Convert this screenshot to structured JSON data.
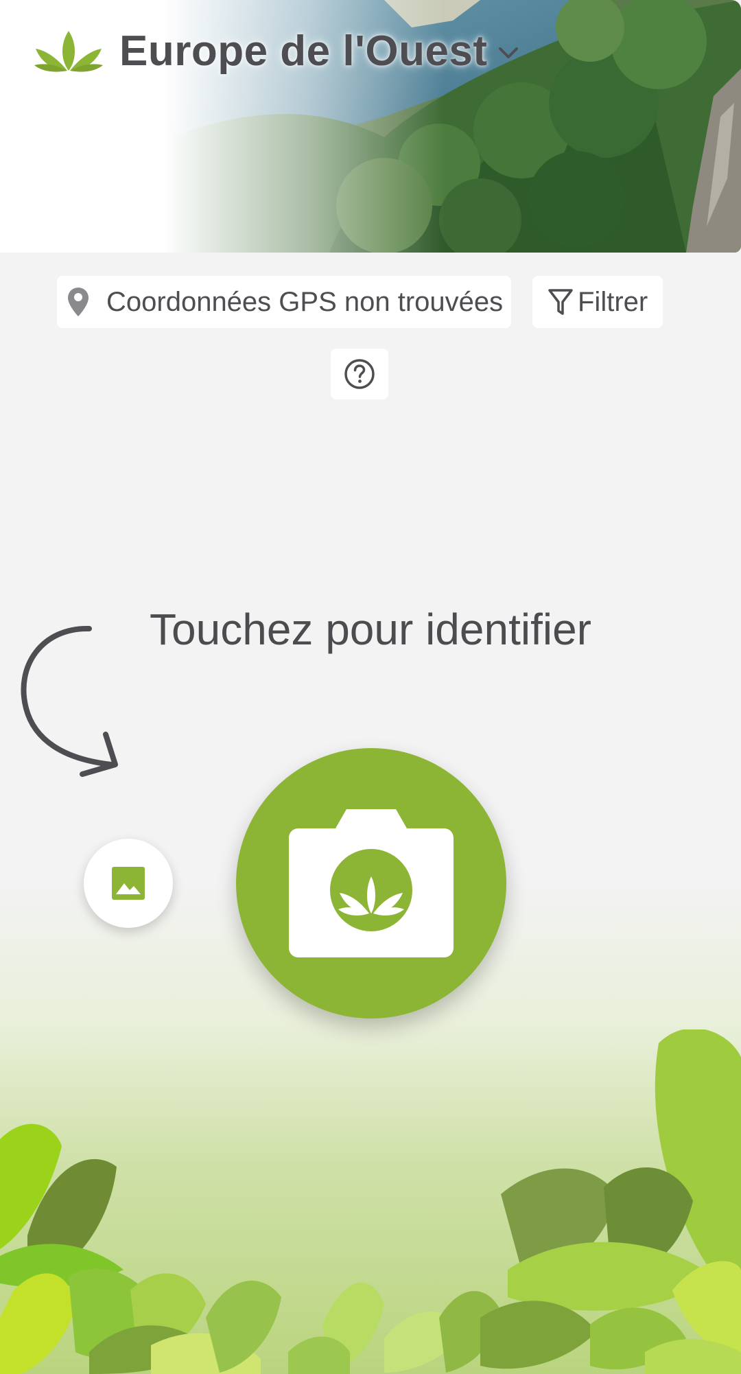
{
  "header": {
    "region_title": "Europe de l'Ouest",
    "brand_icon": "plantnet-leaf-logo",
    "dropdown_icon": "chevron-down-icon"
  },
  "location": {
    "gps_status": "Coordonnées GPS non trouvées",
    "icon": "location-pin-icon"
  },
  "filter": {
    "label": "Filtrer",
    "icon": "funnel-icon"
  },
  "help": {
    "icon": "question-circle-icon"
  },
  "main": {
    "prompt": "Touchez pour identifier",
    "camera_icon": "camera-leaf-icon",
    "gallery_icon": "image-gallery-icon"
  },
  "colors": {
    "brand_green": "#8db535",
    "text_dark": "#4d4d52",
    "background": "#f3f3f3"
  }
}
